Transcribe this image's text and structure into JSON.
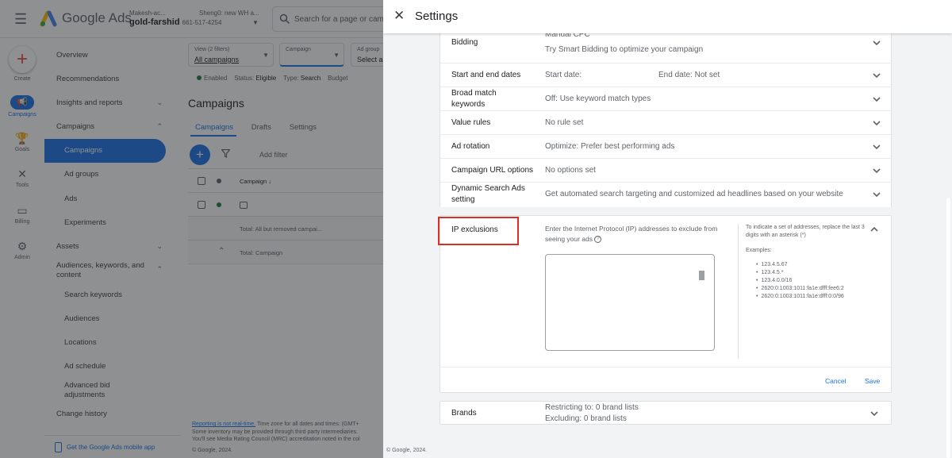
{
  "app": {
    "logo_text": "Google Ads",
    "account_line1": "Makesh-ac...",
    "account_name": "gold-farshid",
    "account_number": "661-517-4254",
    "account_line2": "Sheng0: new WH a...",
    "search_placeholder": "Search for a page or campaign",
    "brand_colors": {
      "blue": "#4285f4",
      "yellow": "#fbbc04",
      "green": "#34a853",
      "red": "#ea4335"
    }
  },
  "rail": {
    "create": "Create",
    "campaigns": "Campaigns",
    "goals": "Goals",
    "tools": "Tools",
    "billing": "Billing",
    "admin": "Admin"
  },
  "nav": {
    "overview": "Overview",
    "recommendations": "Recommendations",
    "insights": "Insights and reports",
    "campaigns_group": "Campaigns",
    "campaigns": "Campaigns",
    "ad_groups": "Ad groups",
    "ads": "Ads",
    "experiments": "Experiments",
    "assets": "Assets",
    "audiences": "Audiences, keywords, and content",
    "search_keywords": "Search keywords",
    "audiences_sub": "Audiences",
    "locations": "Locations",
    "ad_schedule": "Ad schedule",
    "advanced_bid": "Advanced bid adjustments",
    "change_history": "Change history",
    "mobile_app": "Get the Google Ads mobile app"
  },
  "main": {
    "view_label": "View (2 filters)",
    "view_value": "All campaigns",
    "campaign_label": "Campaign",
    "adgroup_label": "Ad group",
    "adgroup_value": "Select a...",
    "status_enabled": "Enabled",
    "status_label": "Status:",
    "status_value": "Eligible",
    "type_label": "Type:",
    "type_value": "Search",
    "budget_label": "Budget",
    "page_title": "Campaigns",
    "tab_campaigns": "Campaigns",
    "tab_drafts": "Drafts",
    "tab_settings": "Settings",
    "add_filter": "Add filter",
    "col_campaign": "Campaign ↓",
    "total_all": "Total: All but removed campai...",
    "total_campaign": "Total: Campaign",
    "footer_link": "Reporting is not real-time.",
    "footer_line1": "Time zone for all dates and times: (GMT+",
    "footer_line2": "Some inventory may be provided through third party intermediaries.",
    "footer_line3": "You'll see Media Rating Council (MRC) accreditation noted in the col",
    "copyright": "© Google, 2024."
  },
  "settings": {
    "title": "Settings",
    "rows": [
      {
        "label": "Bidding",
        "value_top": "Manual CPC",
        "value_link": "Try Smart Bidding to optimize your campaign"
      },
      {
        "label": "Start and end dates",
        "value": "Start date:",
        "value_right": "End date: Not set"
      },
      {
        "label": "Broad match keywords",
        "value": "Off: Use keyword match types"
      },
      {
        "label": "Value rules",
        "value": "No rule set"
      },
      {
        "label": "Ad rotation",
        "value": "Optimize: Prefer best performing ads"
      },
      {
        "label": "Campaign URL options",
        "value": "No options set"
      },
      {
        "label": "Dynamic Search Ads setting",
        "value": "Get automated search targeting and customized ad headlines based on your website"
      }
    ],
    "ip": {
      "label": "IP exclusions",
      "description": "Enter the Internet Protocol (IP) addresses to exclude from seeing your ads",
      "help_glyph": "?",
      "textarea_value": "",
      "hint": "To indicate a set of addresses, replace the last 3 digits with an asterisk (*)",
      "examples_title": "Examples:",
      "examples": [
        "123.4.5.67",
        "123.4.5.*",
        "123.4.0.0/16",
        "2620:0:1003:1011:fa1e:dfff:fee6:2",
        "2620:0:1003:1011:fa1e:dfff:0:0/96"
      ],
      "cancel": "Cancel",
      "save": "Save",
      "highlight_color": "#d93025"
    },
    "brands": {
      "label": "Brands",
      "restricting": "Restricting to: 0 brand lists",
      "excluding": "Excluding: 0 brand lists"
    },
    "copyright": "© Google, 2024."
  }
}
